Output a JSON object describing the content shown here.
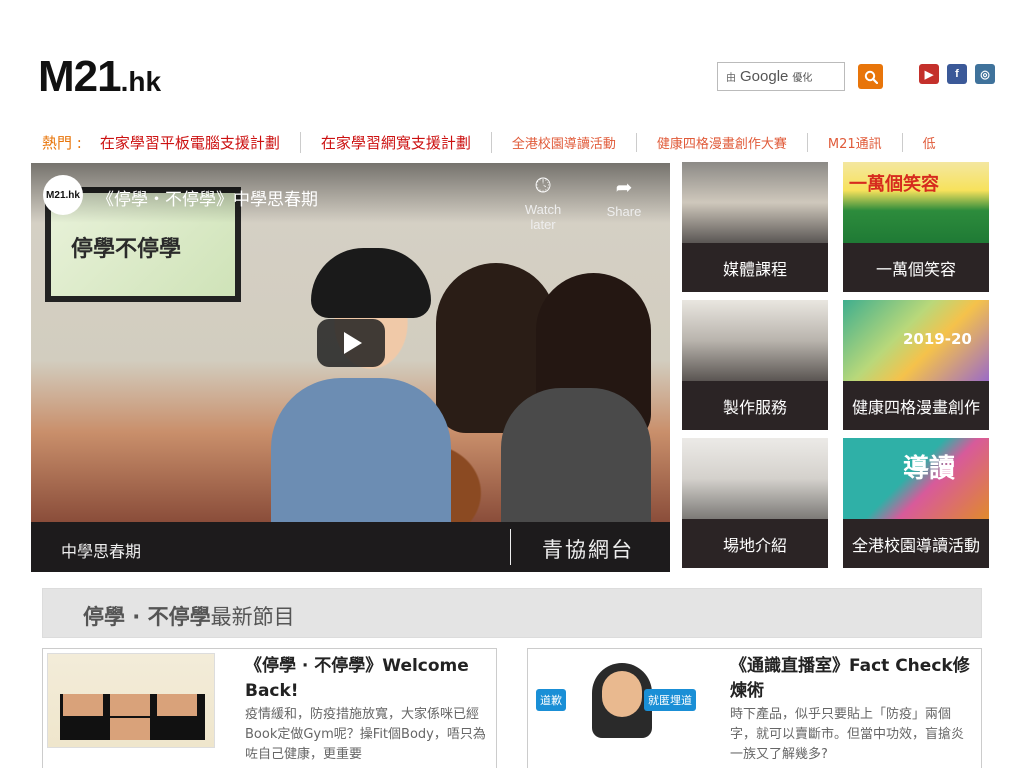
{
  "logo": {
    "main": "M21",
    "suffix": ".hk"
  },
  "search": {
    "by": "由",
    "brand": "Google",
    "enhanced": "優化"
  },
  "social": {
    "youtube": "▶",
    "facebook": "f",
    "instagram": "◎"
  },
  "hotnav": {
    "label": "熱門 :",
    "items": [
      "在家學習平板電腦支援計劃",
      "在家學習網寬支援計劃",
      "全港校園導讀活動",
      "健康四格漫畫創作大賽",
      "M21通訊",
      "低"
    ]
  },
  "video": {
    "channel_avatar": "M21.hk",
    "title": "《停學・不停學》中學思春期",
    "tv_text": "停學不停學",
    "watch_later": "Watch later",
    "share": "Share",
    "bar_left": "中學思春期",
    "bar_right": "青協網台"
  },
  "tiles": [
    {
      "caption": "媒體課程"
    },
    {
      "caption": "一萬個笑容",
      "overlay": "一萬個笑容"
    },
    {
      "caption": "製作服務"
    },
    {
      "caption": "健康四格漫畫創作",
      "overlay": "2019-20"
    },
    {
      "caption": "場地介紹"
    },
    {
      "caption": "全港校園導讀活動",
      "overlay": "導讀"
    }
  ],
  "section": {
    "bold": "停學 · 不停學",
    "rest": "最新節目"
  },
  "cards": [
    {
      "title": "《停學 · 不停學》Welcome Back!",
      "desc": "疫情緩和，防疫措施放寬，大家係咪已經Book定做Gym呢？操Fit個Body，唔只為咗自己健康，更重要"
    },
    {
      "title": "《通識直播室》Fact Check修煉術",
      "desc": "時下產品，似乎只要貼上「防疫」兩個字，就可以賣斷市。但當中功效，盲搶炎一族又了解幾多?",
      "tag_left": "道歉",
      "tag_right": "就匿埋道"
    }
  ]
}
